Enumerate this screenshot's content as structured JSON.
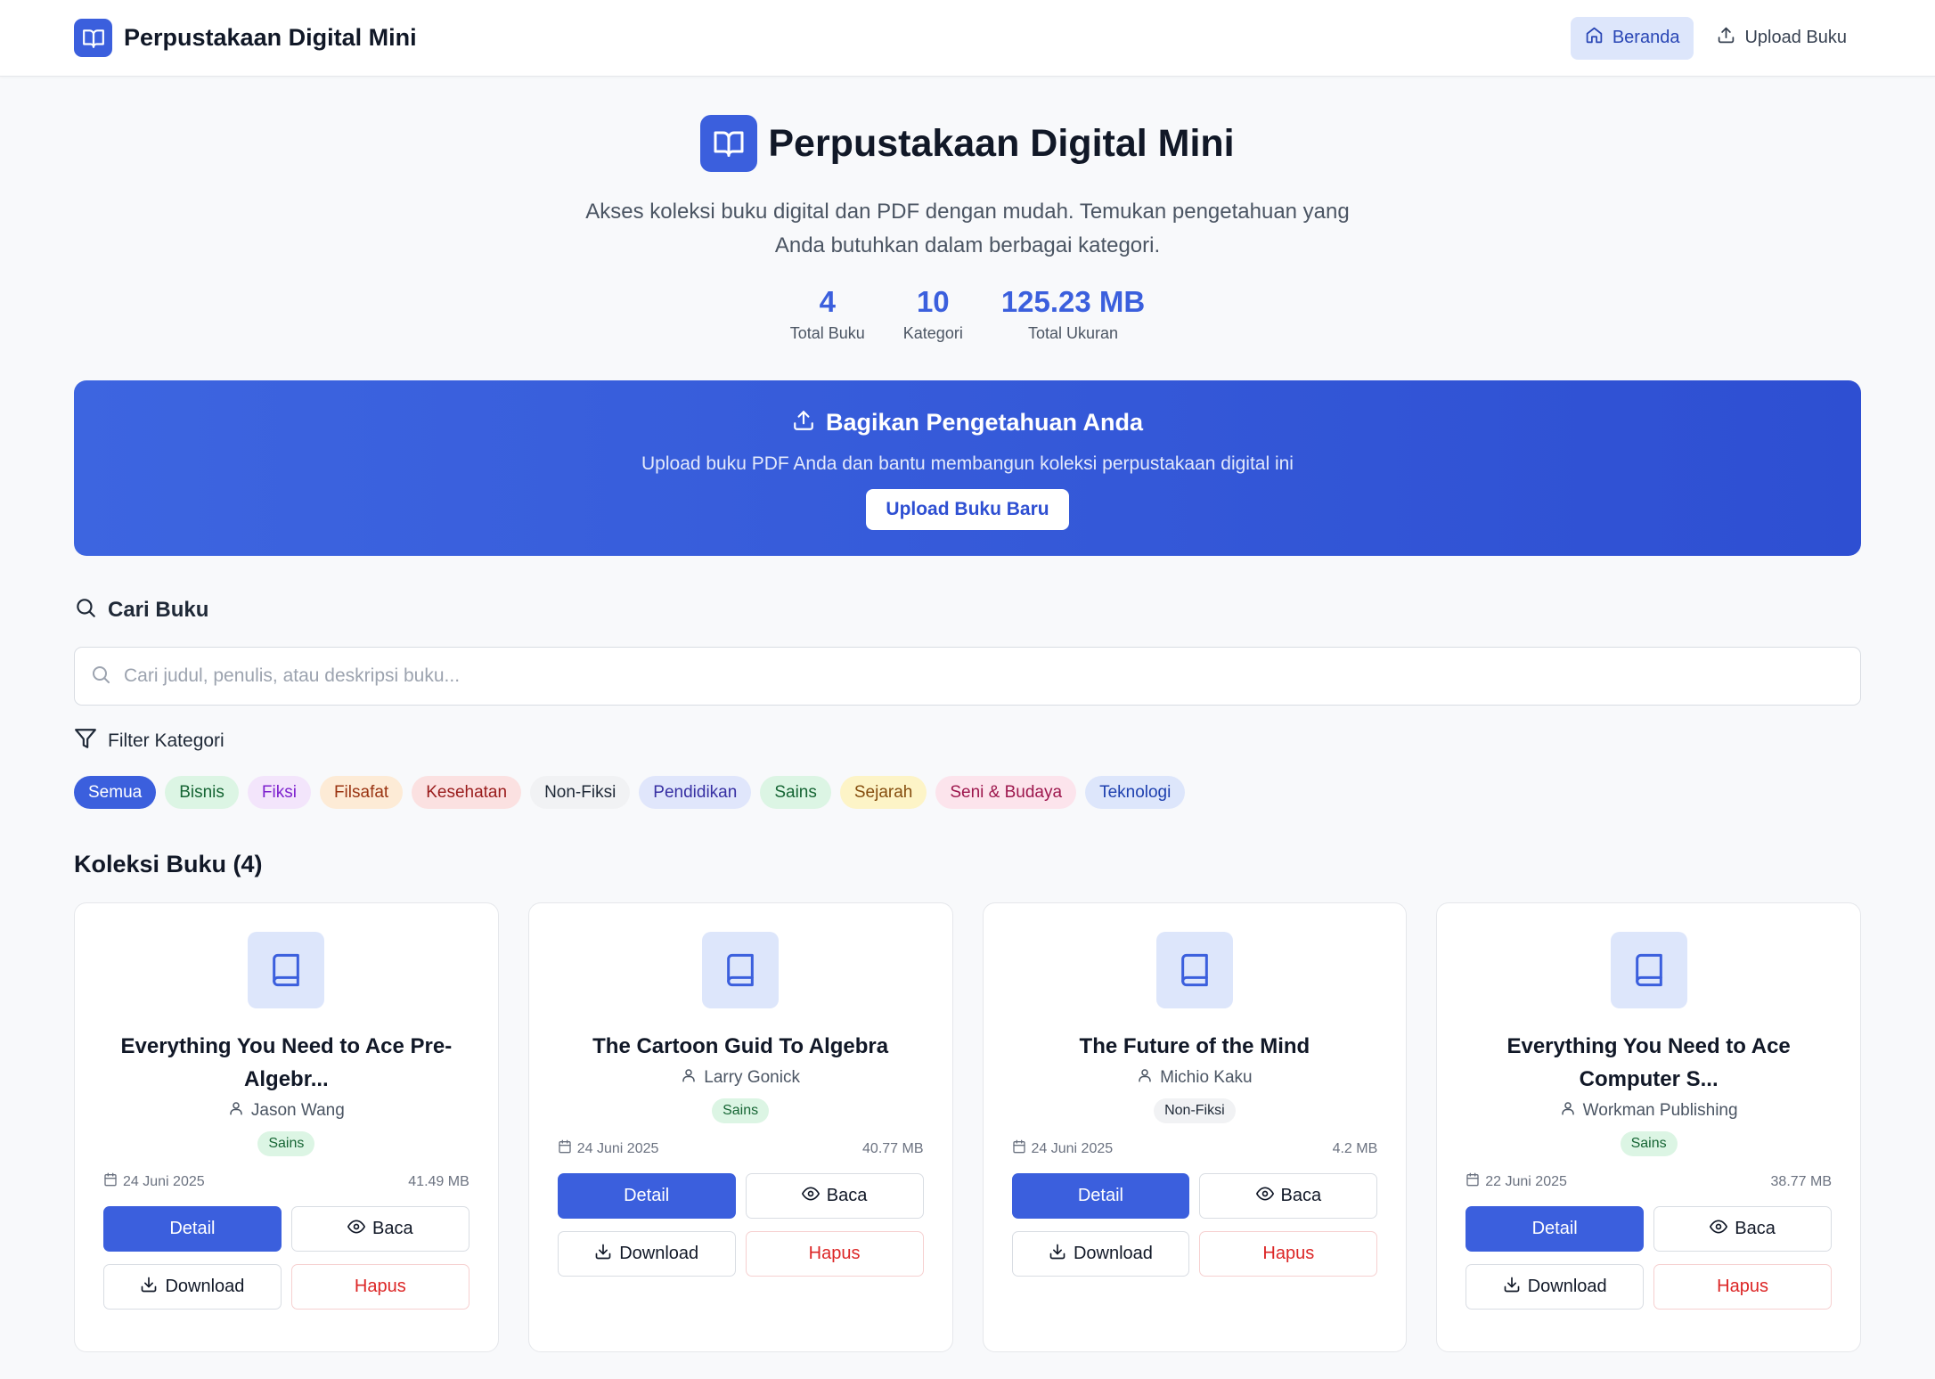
{
  "nav": {
    "brand_title": "Perpustakaan Digital Mini",
    "links": [
      {
        "label": "Beranda",
        "icon": "home-icon",
        "active": true
      },
      {
        "label": "Upload Buku",
        "icon": "upload-icon",
        "active": false
      }
    ]
  },
  "hero": {
    "title": "Perpustakaan Digital Mini",
    "description": "Akses koleksi buku digital dan PDF dengan mudah. Temukan pengetahuan yang Anda butuhkan dalam berbagai kategori.",
    "stats": [
      {
        "value": "4",
        "label": "Total Buku"
      },
      {
        "value": "10",
        "label": "Kategori"
      },
      {
        "value": "125.23 MB",
        "label": "Total Ukuran"
      }
    ]
  },
  "banner": {
    "title": "Bagikan Pengetahuan Anda",
    "description": "Upload buku PDF Anda dan bantu membangun koleksi perpustakaan digital ini",
    "button_label": "Upload Buku Baru"
  },
  "search": {
    "heading": "Cari Buku",
    "placeholder": "Cari judul, penulis, atau deskripsi buku...",
    "value": ""
  },
  "filter": {
    "heading": "Filter Kategori",
    "categories": [
      {
        "label": "Semua",
        "bg": "#3b5fdd",
        "fg": "#ffffff",
        "selected": true
      },
      {
        "label": "Bisnis",
        "bg": "#dcf5e4",
        "fg": "#166534",
        "selected": false
      },
      {
        "label": "Fiksi",
        "bg": "#f3e5fb",
        "fg": "#7e22ce",
        "selected": false
      },
      {
        "label": "Filsafat",
        "bg": "#fdebd6",
        "fg": "#9a3412",
        "selected": false
      },
      {
        "label": "Kesehatan",
        "bg": "#fbe1e1",
        "fg": "#991b1b",
        "selected": false
      },
      {
        "label": "Non-Fiksi",
        "bg": "#f1f2f4",
        "fg": "#1f2937",
        "selected": false
      },
      {
        "label": "Pendidikan",
        "bg": "#e0e6fb",
        "fg": "#3730a3",
        "selected": false
      },
      {
        "label": "Sains",
        "bg": "#dcf5e4",
        "fg": "#166534",
        "selected": false
      },
      {
        "label": "Sejarah",
        "bg": "#fdf4c7",
        "fg": "#854d0e",
        "selected": false
      },
      {
        "label": "Seni & Budaya",
        "bg": "#fce4ec",
        "fg": "#9d174d",
        "selected": false
      },
      {
        "label": "Teknologi",
        "bg": "#dde6fb",
        "fg": "#1e40af",
        "selected": false
      }
    ]
  },
  "collection": {
    "title": "Koleksi Buku (4)",
    "books": [
      {
        "title": "Everything You Need to Ace Pre-Algebr...",
        "author": "Jason Wang",
        "category": "Sains",
        "tag_bg": "#dcf5e4",
        "tag_fg": "#166534",
        "date": "24 Juni 2025",
        "size": "41.49 MB"
      },
      {
        "title": "The Cartoon Guid To Algebra",
        "author": "Larry Gonick",
        "category": "Sains",
        "tag_bg": "#dcf5e4",
        "tag_fg": "#166534",
        "date": "24 Juni 2025",
        "size": "40.77 MB"
      },
      {
        "title": "The Future of the Mind",
        "author": "Michio Kaku",
        "category": "Non-Fiksi",
        "tag_bg": "#f1f2f4",
        "tag_fg": "#1f2937",
        "date": "24 Juni 2025",
        "size": "4.2 MB"
      },
      {
        "title": "Everything You Need to Ace Computer S...",
        "author": "Workman Publishing",
        "category": "Sains",
        "tag_bg": "#dcf5e4",
        "tag_fg": "#166534",
        "date": "22 Juni 2025",
        "size": "38.77 MB"
      }
    ],
    "buttons": {
      "detail": "Detail",
      "read": "Baca",
      "download": "Download",
      "delete": "Hapus"
    }
  },
  "colors": {
    "primary": "#3b5fdd",
    "danger": "#dc2626"
  }
}
